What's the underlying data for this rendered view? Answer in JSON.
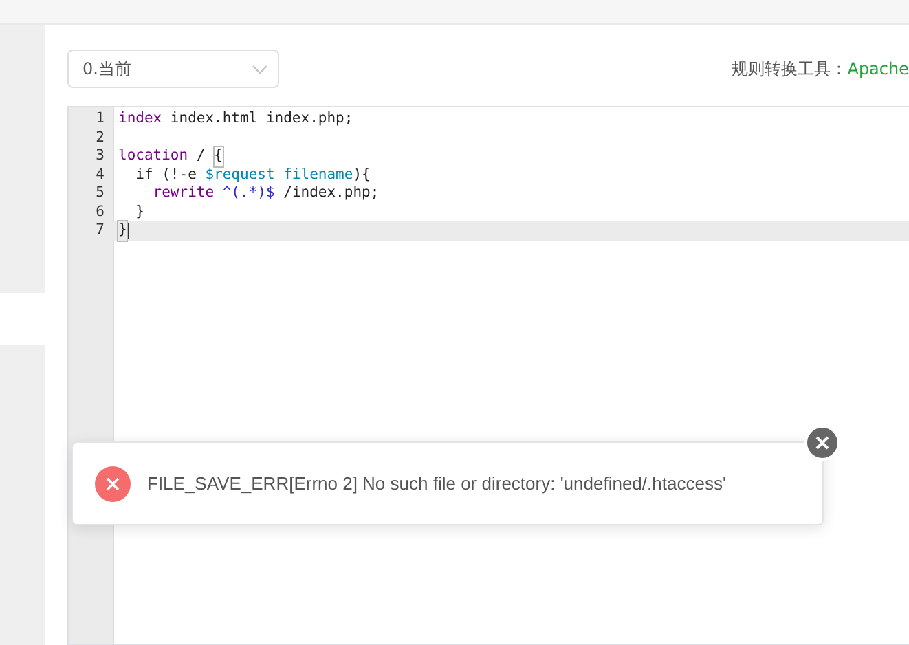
{
  "version_select": {
    "value": "0.当前"
  },
  "converter": {
    "label": "规则转换工具：",
    "link": "Apache"
  },
  "editor": {
    "lines": [
      {
        "number": "1",
        "active": false,
        "tokens": [
          {
            "text": "index",
            "kind": "keyword"
          },
          {
            "text": " index.html index.php;",
            "kind": "plain"
          }
        ]
      },
      {
        "number": "2",
        "active": false
      },
      {
        "number": "3",
        "active": false,
        "tokens": [
          {
            "text": "location",
            "kind": "keyword"
          },
          {
            "text": " / ",
            "kind": "plain"
          },
          {
            "text": "{",
            "kind": "match"
          }
        ]
      },
      {
        "number": "4",
        "active": false,
        "tokens": [
          {
            "text": "  if (!-e ",
            "kind": "plain"
          },
          {
            "text": "$request_filename",
            "kind": "variable"
          },
          {
            "text": "){",
            "kind": "plain"
          }
        ]
      },
      {
        "number": "5",
        "active": false,
        "tokens": [
          {
            "text": "    rewrite ",
            "kind": "keyword"
          },
          {
            "text": "^(.*)$",
            "kind": "regex"
          },
          {
            "text": " /index.php;",
            "kind": "plain"
          }
        ]
      },
      {
        "number": "6",
        "active": false,
        "tokens": [
          {
            "text": "  }",
            "kind": "plain"
          }
        ]
      },
      {
        "number": "7",
        "active": true,
        "tokens": [
          {
            "text": "}",
            "kind": "match"
          }
        ]
      }
    ]
  },
  "toast": {
    "kind": "error",
    "message": "FILE_SAVE_ERR[Errno 2] No such file or directory: 'undefined/.htaccess'"
  }
}
